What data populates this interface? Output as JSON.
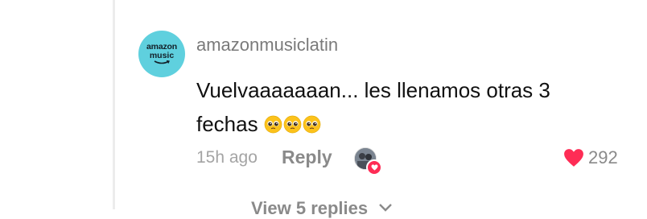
{
  "comment": {
    "avatar_line1": "amazon",
    "avatar_line2": "music",
    "username": "amazonmusiclatin",
    "text_line1": "Vuelvaaaaaaan... les llenamos otras 3",
    "text_line2": "fechas",
    "emoji_count": 3,
    "emoji_name": "pleading-face",
    "time_ago": "15h ago",
    "reply_label": "Reply",
    "creator_liked_badge": "heart-icon",
    "like_count": "292",
    "accent_color": "#fe2c55",
    "view_replies_label": "View 5 replies"
  }
}
